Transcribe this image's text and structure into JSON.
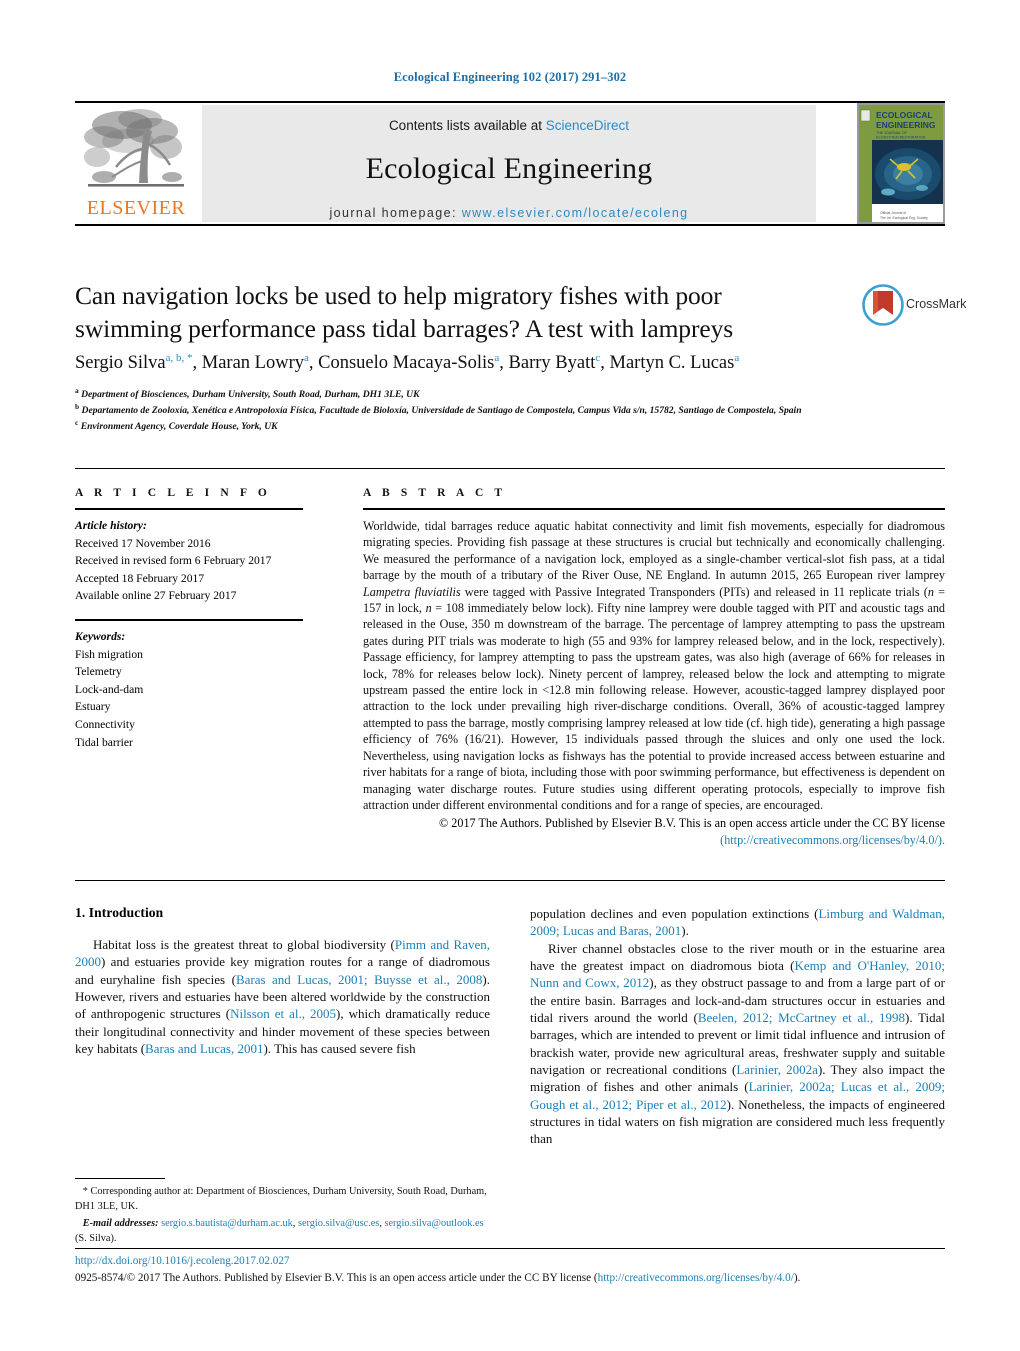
{
  "running_head": "Ecological Engineering 102 (2017) 291–302",
  "masthead": {
    "publisher_name": "ELSEVIER",
    "contents_prefix": "Contents lists available at ",
    "contents_link": "ScienceDirect",
    "journal_title": "Ecological Engineering",
    "homepage_prefix": "journal homepage: ",
    "homepage_link": "www.elsevier.com/locate/ecoleng",
    "cover": {
      "line1": "ECOLOGICAL",
      "line2": "ENGINEERING",
      "line3": "THE JOURNAL OF",
      "line4": "ECOSYSTEM RESTORATION",
      "footer1": "Official Journal of",
      "footer2": "The International Ecological Engineering Society"
    }
  },
  "crossmark": {
    "label": "CrossMark"
  },
  "article": {
    "title": "Can navigation locks be used to help migratory fishes with poor swimming performance pass tidal barrages? A test with lampreys",
    "authors": [
      {
        "name": "Sergio Silva",
        "sup": "a, b, *"
      },
      {
        "name": "Maran Lowry",
        "sup": "a"
      },
      {
        "name": "Consuelo Macaya-Solis",
        "sup": "a"
      },
      {
        "name": "Barry Byatt",
        "sup": "c"
      },
      {
        "name": "Martyn C. Lucas",
        "sup": "a"
      }
    ],
    "affiliations": [
      {
        "marker": "a",
        "text": "Department of Biosciences, Durham University, South Road, Durham, DH1 3LE, UK"
      },
      {
        "marker": "b",
        "text": "Departamento de Zooloxía, Xenética e Antropoloxía Física, Facultade de Bioloxía, Universidade de Santiago de Compostela, Campus Vida s/n, 15782, Santiago de Compostela, Spain"
      },
      {
        "marker": "c",
        "text": "Environment Agency, Coverdale House, York, UK"
      }
    ]
  },
  "article_info": {
    "heading": "A R T I C L E   I N F O",
    "history_label": "Article history:",
    "history": [
      "Received 17 November 2016",
      "Received in revised form 6 February 2017",
      "Accepted 18 February 2017",
      "Available online 27 February 2017"
    ],
    "keywords_label": "Keywords:",
    "keywords": [
      "Fish migration",
      "Telemetry",
      "Lock-and-dam",
      "Estuary",
      "Connectivity",
      "Tidal barrier"
    ]
  },
  "abstract": {
    "heading": "A B S T R A C T",
    "text_1": "Worldwide, tidal barrages reduce aquatic habitat connectivity and limit fish movements, especially for diadromous migrating species. Providing fish passage at these structures is crucial but technically and economically challenging. We measured the performance of a navigation lock, employed as a single-chamber vertical-slot fish pass, at a tidal barrage by the mouth of a tributary of the River Ouse, NE England. In autumn 2015, 265 European river lamprey ",
    "species_italic": "Lampetra fluviatilis",
    "text_2": " were tagged with Passive Integrated Transponders (PITs) and released in 11 replicate trials (",
    "n_italic_1": "n",
    "text_3": " = 157 in lock, ",
    "n_italic_2": "n",
    "text_4": " = 108 immediately below lock). Fifty nine lamprey were double tagged with PIT and acoustic tags and released in the Ouse, 350 m downstream of the barrage. The percentage of lamprey attempting to pass the upstream gates during PIT trials was moderate to high (55 and 93% for lamprey released below, and in the lock, respectively). Passage efficiency, for lamprey attempting to pass the upstream gates, was also high (average of 66% for releases in lock, 78% for releases below lock). Ninety percent of lamprey, released below the lock and attempting to migrate upstream passed the entire lock in <12.8 min following release. However, acoustic-tagged lamprey displayed poor attraction to the lock under prevailing high river-discharge conditions. Overall, 36% of acoustic-tagged lamprey attempted to pass the barrage, mostly comprising lamprey released at low tide (cf. high tide), generating a high passage efficiency of 76% (16/21). However, 15 individuals passed through the sluices and only one used the lock. Nevertheless, using navigation locks as fishways has the potential to provide increased access between estuarine and river habitats for a range of biota, including those with poor swimming performance, but effectiveness is dependent on managing water discharge routes. Future studies using different operating protocols, especially to improve fish attraction under different environmental conditions and for a range of species, are encouraged.",
    "copyright": "© 2017 The Authors. Published by Elsevier B.V. This is an open access article under the CC BY license",
    "license_url": "(http://creativecommons.org/licenses/by/4.0/)."
  },
  "body": {
    "section_heading": "1.  Introduction",
    "left_paragraph_1_a": "Habitat loss is the greatest threat to global biodiversity (",
    "left_ref_1": "Pimm and Raven, 2000",
    "left_paragraph_1_b": ") and estuaries provide key migration routes for a range of diadromous and euryhaline fish species (",
    "left_ref_2": "Baras and Lucas, 2001; Buysse et al., 2008",
    "left_paragraph_1_c": "). However, rivers and estuaries have been altered worldwide by the construction of anthropogenic structures (",
    "left_ref_3": "Nilsson et al., 2005",
    "left_paragraph_1_d": "), which dramatically reduce their longitudinal connectivity and hinder movement of these species between key habitats (",
    "left_ref_4": "Baras and Lucas, 2001",
    "left_paragraph_1_e": "). This has caused severe fish",
    "right_paragraph_1_a": "population declines and even population extinctions (",
    "right_ref_1": "Limburg and Waldman, 2009; Lucas and Baras, 2001",
    "right_paragraph_1_b": ").",
    "right_paragraph_2_a": "River channel obstacles close to the river mouth or in the estuarine area have the greatest impact on diadromous biota (",
    "right_ref_2": "Kemp and O'Hanley, 2010; Nunn and Cowx, 2012",
    "right_paragraph_2_b": "), as they obstruct passage to and from a large part of or the entire basin. Barrages and lock-and-dam structures occur in estuaries and tidal rivers around the world (",
    "right_ref_3": "Beelen, 2012; McCartney et al., 1998",
    "right_paragraph_2_c": "). Tidal barrages, which are intended to prevent or limit tidal influence and intrusion of brackish water, provide new agricultural areas, freshwater supply and suitable navigation or recreational conditions (",
    "right_ref_4": "Larinier, 2002a",
    "right_paragraph_2_d": "). They also impact the migration of fishes and other animals (",
    "right_ref_5": "Larinier, 2002a; Lucas et al., 2009; Gough et al., 2012; Piper et al., 2012",
    "right_paragraph_2_e": "). Nonetheless, the impacts of engineered structures in tidal waters on fish migration are considered much less frequently than"
  },
  "footnote": {
    "corresponding_marker": "*",
    "corresponding_label": " Corresponding author at: ",
    "corresponding_text": "Department of Biosciences, Durham University, South Road, Durham, DH1 3LE, UK.",
    "email_label": "E-mail addresses:",
    "email_1": "sergio.s.bautista@durham.ac.uk",
    "email_2": "sergio.silva@usc.es",
    "email_3": "sergio.silva@outlook.es",
    "email_suffix": " (S. Silva)."
  },
  "footer": {
    "doi": "http://dx.doi.org/10.1016/j.ecoleng.2017.02.027",
    "issn_copyright": "0925-8574/© 2017 The Authors. Published by Elsevier B.V. This is an open access article under the CC BY license (",
    "issn_link": "http://creativecommons.org/licenses/by/4.0/",
    "issn_suffix": ").",
    "accent_link_color": "#1b7fb5"
  }
}
